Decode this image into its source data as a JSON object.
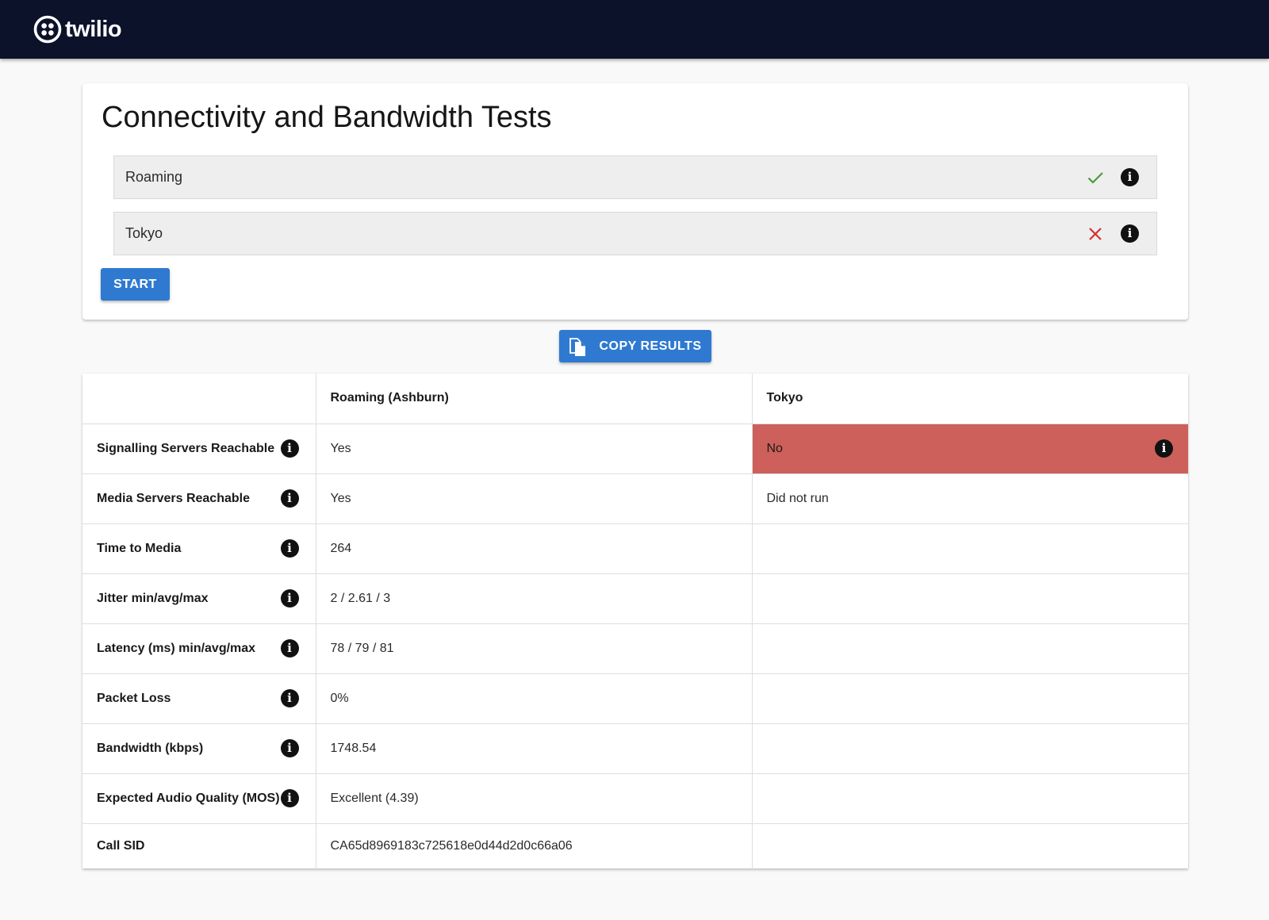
{
  "brand": {
    "name": "twilio",
    "header_color": "#0d122b"
  },
  "page": {
    "title": "Connectivity and Bandwidth Tests"
  },
  "regions": [
    {
      "label": "Roaming",
      "status": "check-icon",
      "status_color": "#4a9a3c"
    },
    {
      "label": "Tokyo",
      "status": "x-icon",
      "status_color": "#d32f2f"
    }
  ],
  "actions": {
    "start_label": "START",
    "copy_label": "COPY RESULTS",
    "button_color": "#2f7ad0"
  },
  "results": {
    "columns": [
      "",
      "Roaming (Ashburn)",
      "Tokyo"
    ],
    "rows": [
      {
        "metric": "Signalling Servers Reachable",
        "values": [
          "Yes",
          "No"
        ]
      },
      {
        "metric": "Media Servers Reachable",
        "values": [
          "Yes",
          "Did not run"
        ]
      },
      {
        "metric": "Time to Media",
        "values": [
          "264",
          ""
        ]
      },
      {
        "metric": "Jitter min/avg/max",
        "values": [
          "2 / 2.61 / 3",
          ""
        ]
      },
      {
        "metric": "Latency (ms) min/avg/max",
        "values": [
          "78 / 79 / 81",
          ""
        ]
      },
      {
        "metric": "Packet Loss",
        "values": [
          "0%",
          ""
        ]
      },
      {
        "metric": "Bandwidth (kbps)",
        "values": [
          "1748.54",
          ""
        ]
      },
      {
        "metric": "Expected Audio Quality (MOS)",
        "values": [
          "Excellent (4.39)",
          ""
        ]
      },
      {
        "metric": "Call SID",
        "values": [
          "CA65d8969183c725618e0d44d2d0c66a06",
          ""
        ]
      }
    ],
    "fail_color": "#cd605a"
  }
}
